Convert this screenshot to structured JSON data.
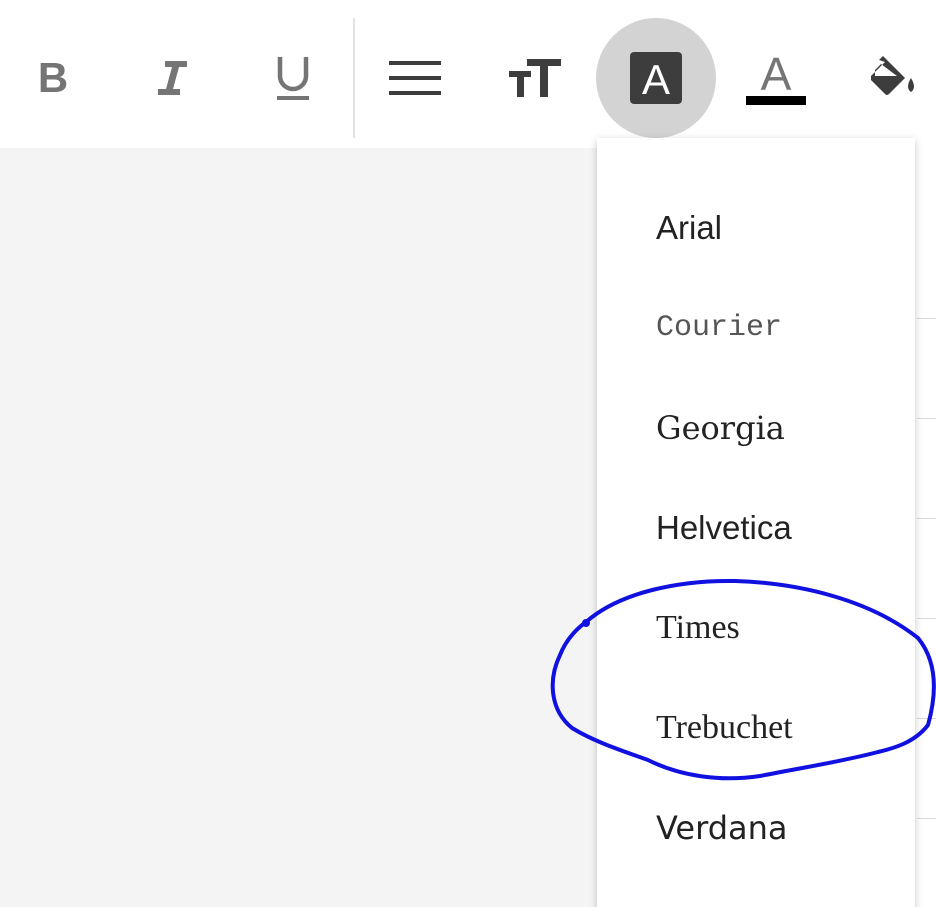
{
  "toolbar": {
    "buttons": [
      {
        "name": "bold",
        "icon": "bold-icon",
        "glyph": "B"
      },
      {
        "name": "italic",
        "icon": "italic-icon",
        "glyph": "I"
      },
      {
        "name": "underline",
        "icon": "underline-icon",
        "glyph": "U"
      },
      {
        "name": "align",
        "icon": "align-justify-icon"
      },
      {
        "name": "font-size",
        "icon": "text-size-icon"
      },
      {
        "name": "font-family",
        "icon": "font-family-icon",
        "glyph": "A",
        "active": true
      },
      {
        "name": "text-color",
        "icon": "text-color-icon",
        "glyph": "A"
      },
      {
        "name": "fill-color",
        "icon": "paint-bucket-icon"
      }
    ],
    "colors": {
      "icon": "#757575",
      "icon_dark": "#3d3d3d",
      "active_bg": "#d3d3d3",
      "text_color_bar": "#000000"
    }
  },
  "font_menu": {
    "items": [
      {
        "label": "Arial"
      },
      {
        "label": "Courier"
      },
      {
        "label": "Georgia"
      },
      {
        "label": "Helvetica"
      },
      {
        "label": "Times"
      },
      {
        "label": "Trebuchet"
      },
      {
        "label": "Verdana"
      }
    ]
  },
  "annotation": {
    "color": "#1010e0",
    "circled_items": [
      "Times",
      "Trebuchet"
    ]
  }
}
